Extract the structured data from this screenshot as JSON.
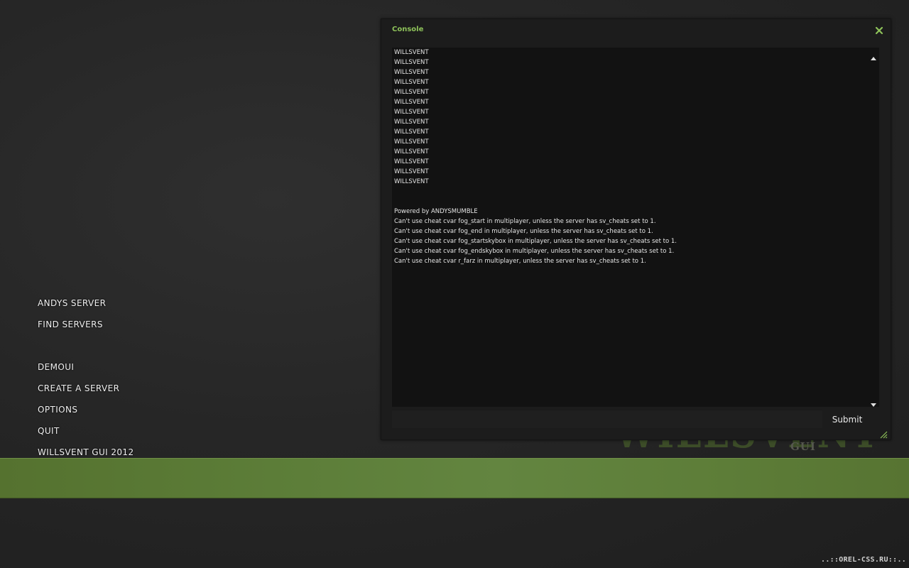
{
  "menu": {
    "items": [
      {
        "label": "ANDYS SERVER"
      },
      {
        "label": "FIND SERVERS"
      },
      {
        "label": "DEMOUI"
      },
      {
        "label": "CREATE A SERVER"
      },
      {
        "label": "OPTIONS"
      },
      {
        "label": "QUIT"
      },
      {
        "label": "WILLSVENT GUI 2012"
      }
    ]
  },
  "logo": {
    "text": "WILLSVENT",
    "sub": "GUI"
  },
  "console": {
    "title": "Console",
    "close_icon": "close-icon",
    "lines_top": [
      "WILLSVENT",
      "WILLSVENT",
      "WILLSVENT",
      "WILLSVENT",
      "WILLSVENT",
      "WILLSVENT",
      "WILLSVENT",
      "WILLSVENT",
      "WILLSVENT",
      "WILLSVENT",
      "WILLSVENT",
      "WILLSVENT",
      "WILLSVENT",
      "WILLSVENT"
    ],
    "lines_bottom": [
      "Powered by ANDYSMUMBLE",
      "Can't use cheat cvar fog_start in multiplayer, unless the server has sv_cheats set to 1.",
      "Can't use cheat cvar fog_end in multiplayer, unless the server has sv_cheats set to 1.",
      "Can't use cheat cvar fog_startskybox in multiplayer, unless the server has sv_cheats set to 1.",
      "Can't use cheat cvar fog_endskybox in multiplayer, unless the server has sv_cheats set to 1.",
      "Can't use cheat cvar r_farz in multiplayer, unless the server has sv_cheats set to 1."
    ],
    "input_value": "",
    "submit_label": "Submit"
  },
  "watermark": "..::OREL-CSS.RU::..",
  "colors": {
    "accent_green": "#8ec25a",
    "bar_green": "#5c7d38",
    "background": "#262626"
  }
}
